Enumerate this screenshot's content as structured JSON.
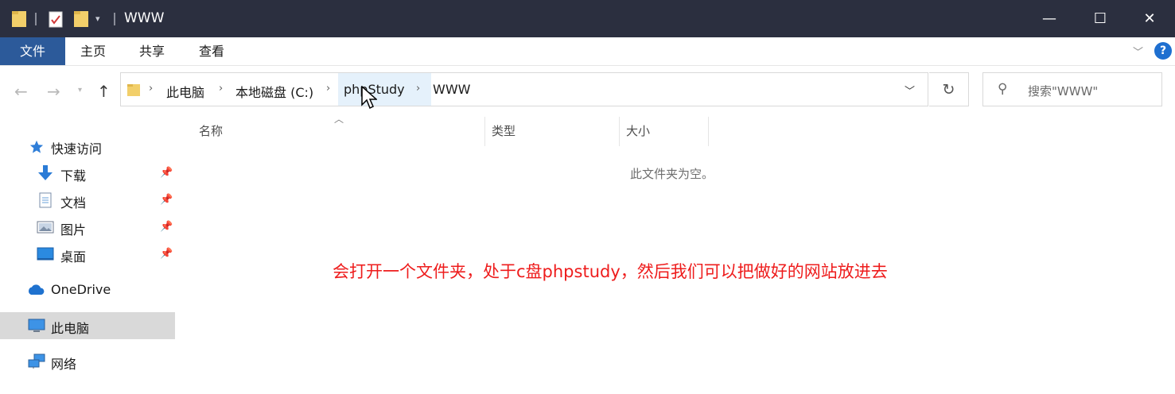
{
  "window": {
    "title": "WWW",
    "minimize_glyph": "—",
    "maximize_glyph": "☐",
    "close_glyph": "✕"
  },
  "ribbon": {
    "tabs": [
      "文件",
      "主页",
      "共享",
      "查看"
    ],
    "help_glyph": "?"
  },
  "address_bar": {
    "crumbs": [
      "此电脑",
      "本地磁盘 (C:)",
      "phpStudy",
      "WWW"
    ],
    "search_placeholder": "搜索\"WWW\""
  },
  "columns": [
    "名称",
    "类型",
    "大小"
  ],
  "empty_message": "此文件夹为空。",
  "sidebar": {
    "quick_access": "快速访问",
    "pinned": [
      {
        "label": "下载",
        "icon": "download-arrow-icon"
      },
      {
        "label": "文档",
        "icon": "document-icon"
      },
      {
        "label": "图片",
        "icon": "pictures-icon"
      },
      {
        "label": "桌面",
        "icon": "desktop-icon"
      }
    ],
    "onedrive": "OneDrive",
    "this_pc": "此电脑",
    "network": "网络"
  },
  "annotation": "会打开一个文件夹，处于c盘phpstudy，然后我们可以把做好的网站放进去",
  "colors": {
    "titlebar": "#2b2f3f",
    "file_tab": "#2c5a9a",
    "annotation": "#ee1c1c",
    "selected": "#d9d9d9"
  }
}
